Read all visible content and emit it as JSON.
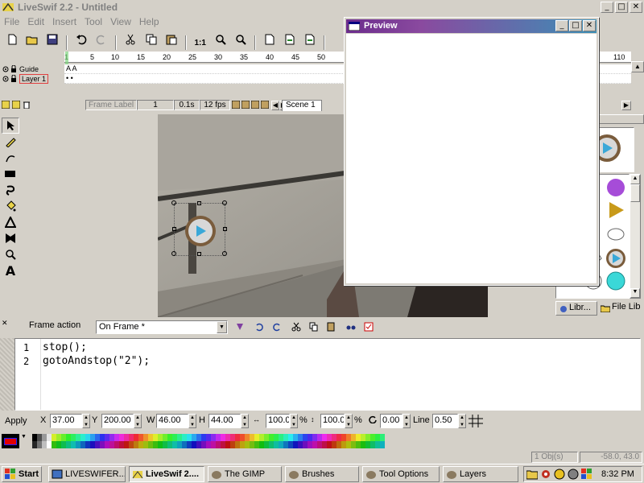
{
  "window": {
    "title": "LiveSwif 2.2 - Untitled",
    "min": "_",
    "max": "□",
    "close": "✕"
  },
  "menu": [
    "File",
    "Edit",
    "Insert",
    "Tool",
    "View",
    "Help"
  ],
  "toolbar": {
    "zoom_ratio": "1:1"
  },
  "timeline": {
    "ruler_ticks": [
      "1",
      "5",
      "10",
      "15",
      "20",
      "25",
      "30",
      "35",
      "40",
      "45",
      "50",
      "110"
    ],
    "layers": [
      {
        "name": "Guide",
        "frames": "A A"
      },
      {
        "name": "Layer 1",
        "frames": "• •"
      }
    ],
    "footer": {
      "frame_label": "Frame Label",
      "frame": "1",
      "time": "0.1s",
      "fps": "12 fps",
      "scene": "Scene 1"
    }
  },
  "preview": {
    "title": "Preview"
  },
  "library": {
    "tabs": [
      "Libr...",
      "File Lib"
    ]
  },
  "action_editor": {
    "label": "Frame action",
    "event": "On Frame *",
    "lines": [
      {
        "no": "1",
        "code": "stop();"
      },
      {
        "no": "2",
        "code": "gotoAndstop(\"2\");"
      }
    ]
  },
  "properties": {
    "apply": "Apply",
    "x_label": "X",
    "x": "37.00",
    "y_label": "Y",
    "y": "200.00",
    "w_label": "W",
    "w": "46.00",
    "h_label": "H",
    "h": "44.00",
    "scale_x": "100.0",
    "scale_y": "100.0",
    "pct": "%",
    "rotation": "0.00",
    "line_label": "Line",
    "line": "0.50"
  },
  "status": {
    "objects": "1 Obj(s)",
    "coords": "-58.0, 43.0"
  },
  "taskbar": {
    "start": "Start",
    "tasks": [
      "LIVESWIFER...",
      "LiveSwif 2....",
      "The GIMP",
      "Brushes",
      "Tool Options",
      "Layers"
    ],
    "clock": "8:32 PM"
  },
  "colors": {
    "preview_gradient_start": "#6b2c8c",
    "preview_gradient_end": "#3b8fb6",
    "frame_cursor": "#e04040",
    "stage_button_ring": "#7a5c3c"
  }
}
